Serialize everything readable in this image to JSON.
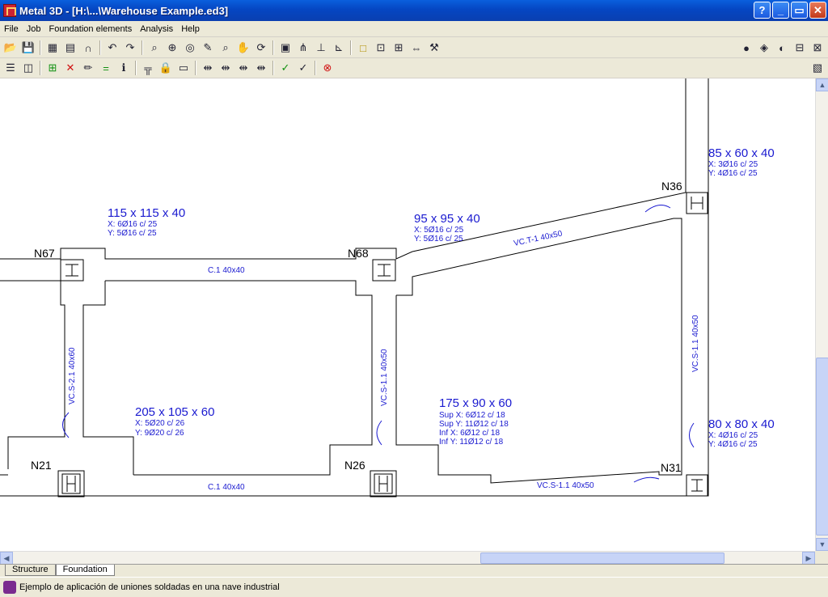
{
  "window": {
    "title": "Metal 3D - [H:\\...\\Warehouse Example.ed3]",
    "min": "_",
    "restore": "▭",
    "close": "✕",
    "help": "?"
  },
  "menu": [
    "File",
    "Job",
    "Foundation elements",
    "Analysis",
    "Help"
  ],
  "toolbar1": [
    "open-icon",
    "save-icon",
    "sep",
    "print-icon",
    "print-preview-icon",
    "magnet-icon",
    "sep",
    "undo-icon",
    "redo-icon",
    "sep",
    "zoom-window-icon",
    "zoom-in-icon",
    "zoom-all-icon",
    "measure-icon",
    "zoom-previous-icon",
    "pan-hand-icon",
    "refresh-icon",
    "sep",
    "view-3d-icon",
    "node-icon",
    "support-icon",
    "axes-icon",
    "sep",
    "square-icon",
    "snap-icon",
    "grid-icon",
    "dimension-icon",
    "tools-icon"
  ],
  "toolbar1_right": [
    "globe-icon",
    "layers-icon",
    "print-setup-icon",
    "window-a-icon",
    "window-b-icon"
  ],
  "toolbar2": [
    "list-icon",
    "box-icon",
    "sep",
    "add-icon",
    "delete-icon",
    "edit-icon",
    "equal-icon",
    "info-icon",
    "sep",
    "beam-icon",
    "lock-icon",
    "tie-icon",
    "sep",
    "align-a-icon",
    "align-b-icon",
    "align-c-icon",
    "align-d-icon",
    "sep",
    "check-icon",
    "check-edit-icon",
    "sep",
    "stop-icon"
  ],
  "toolbar2_right": [
    "report-icon"
  ],
  "drawing": {
    "nodes": [
      "N67",
      "N68",
      "N36",
      "N21",
      "N26",
      "N31"
    ],
    "footings": [
      {
        "dims": "115 x 115 x 40",
        "x": "X: 6Ø16 c/ 25",
        "y": "Y: 5Ø16 c/ 25"
      },
      {
        "dims": "95 x 95 x 40",
        "x": "X: 5Ø16 c/ 25",
        "y": "Y: 5Ø16 c/ 25"
      },
      {
        "dims": "85 x 60 x 40",
        "x": "X: 3Ø16 c/ 25",
        "y": "Y: 4Ø16 c/ 25"
      },
      {
        "dims": "205 x 105 x 60",
        "x": "X: 5Ø20 c/ 26",
        "y": "Y: 9Ø20 c/ 26"
      },
      {
        "dims": "175 x 90 x 60",
        "sx": "Sup X: 6Ø12 c/ 18",
        "sy": "Sup Y: 11Ø12 c/ 18",
        "ix": "Inf X: 6Ø12 c/ 18",
        "iy": "Inf Y: 11Ø12 c/ 18"
      },
      {
        "dims": "80 x 80 x 40",
        "x": "X: 4Ø16 c/ 25",
        "y": "Y: 4Ø16 c/ 25"
      }
    ],
    "beams": [
      "C.1 40x40",
      "VC.T-1 40x50",
      "VC.S-2.1 40x60",
      "VC.S-1.1 40x50",
      "C.1 40x40",
      "VC.S-1.1 40x50",
      "VC.S-1.1 40x50"
    ]
  },
  "tabs": [
    "Structure",
    "Foundation"
  ],
  "status": "Ejemplo de aplicación de uniones soldadas en una nave industrial"
}
